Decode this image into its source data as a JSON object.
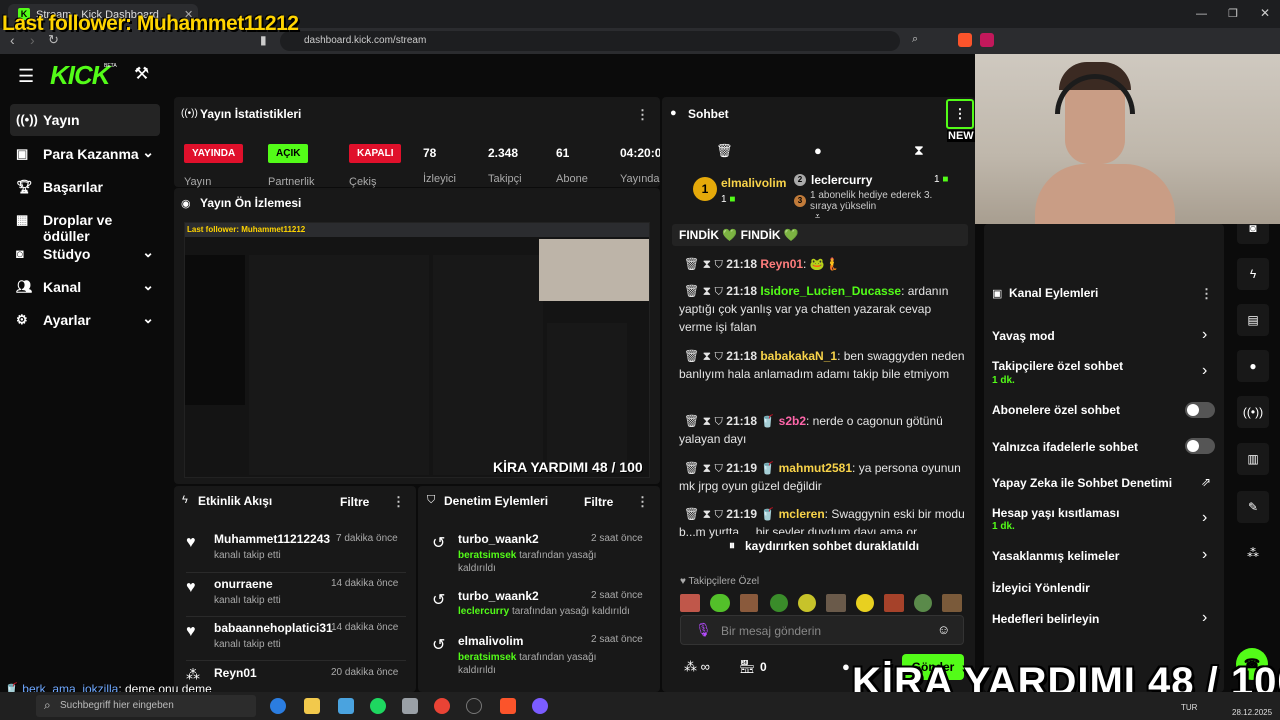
{
  "browser": {
    "tab_title": "Stream - Kick Dashboard",
    "url": "dashboard.kick.com/stream"
  },
  "overlay": {
    "last_follower": "Last follower: Muhammet11212",
    "big_text": "KİRA YARDIMI  48 / 100",
    "chat_overlay_user": "berk_ama_jokzilla",
    "chat_overlay_text": ": deme onu deme"
  },
  "logo": {
    "text": "KICK",
    "beta": "BETA"
  },
  "sidebar": {
    "items": [
      {
        "label": "Yayın",
        "icon": "broadcast-icon"
      },
      {
        "label": "Para Kazanma",
        "icon": "money-icon"
      },
      {
        "label": "Başarılar",
        "icon": "trophy-icon"
      },
      {
        "label": "Droplar ve ödüller",
        "icon": "gift-icon"
      },
      {
        "label": "Stüdyo",
        "icon": "studio-icon"
      },
      {
        "label": "Kanal",
        "icon": "users-icon"
      },
      {
        "label": "Ayarlar",
        "icon": "gear-icon"
      }
    ]
  },
  "stats": {
    "title": "Yayın İstatistikleri",
    "badges": [
      {
        "text": "YAYINDA",
        "label": "Yayın",
        "color": "#e0102b"
      },
      {
        "text": "AÇIK",
        "label": "Partnerlik",
        "color": "#53fc18"
      },
      {
        "text": "KAPALI",
        "label": "Çekiş",
        "color": "#e0102b"
      }
    ],
    "numbers": [
      {
        "value": "78",
        "label": "İzleyici"
      },
      {
        "value": "2.348",
        "label": "Takipçi"
      },
      {
        "value": "61",
        "label": "Abone"
      },
      {
        "value": "04:20:0",
        "label": "Yayında"
      }
    ]
  },
  "preview": {
    "title": "Yayın Ön İzlemesi",
    "inner_follower": "Last follower: Muhammet11212",
    "inner_big": "KİRA YARDIMI  48 / 100"
  },
  "activity": {
    "title": "Etkinlik Akışı",
    "filter": "Filtre",
    "items": [
      {
        "name": "Muhammet11212243",
        "sub": "kanalı takip etti",
        "time": "7 dakika önce"
      },
      {
        "name": "onurraene",
        "sub": "kanalı takip etti",
        "time": "14 dakika önce"
      },
      {
        "name": "babaannehoplatici31",
        "sub": "kanalı takip etti",
        "time": "14 dakika önce"
      },
      {
        "name": "Reyn01",
        "sub": "",
        "time": "20 dakika önce"
      }
    ]
  },
  "moderation": {
    "title": "Denetim Eylemleri",
    "filter": "Filtre",
    "items": [
      {
        "user": "turbo_waank2",
        "by": "beratsimsek",
        "text": "tarafından yasağı kaldırıldı",
        "time": "2 saat önce"
      },
      {
        "user": "turbo_waank2",
        "by": "leclercurry",
        "text": "tarafından yasağı kaldırıldı",
        "time": "2 saat önce"
      },
      {
        "user": "elmalivolim",
        "by": "beratsimsek",
        "text": "tarafından yasağı kaldırıldı",
        "time": "2 saat önce"
      }
    ]
  },
  "chat": {
    "title": "Sohbet",
    "new_label": "NEW",
    "top_gifter": {
      "name": "elmalivolim",
      "count": "1",
      "rank": "1"
    },
    "gift_user": {
      "name": "leclercurry",
      "count": "1",
      "text": "1 abonelik hediye ederek 3. sıraya yükselin",
      "rank": "3"
    },
    "pinned": "FINDİK 💚 FINDİK 💚",
    "messages": [
      {
        "time": "21:18",
        "user": "Reyn01",
        "color": "#ff7d7d",
        "text": "🐸🧜"
      },
      {
        "time": "21:18",
        "user": "Isidore_Lucien_Ducasse",
        "color": "#53fc18",
        "text": "ardanın yaptığı çok yanlış var ya chatten yazarak cevap verme işi falan"
      },
      {
        "time": "21:18",
        "user": "babakakaN_1",
        "color": "#f8d34a",
        "text": "ben swaggyden neden banlıyım hala anlamadım adamı takip bile etmiyom"
      },
      {
        "time": "21:18",
        "user": "s2b2",
        "color": "#ff66aa",
        "text": "nerde o cagonun götünü yalayan dayı"
      },
      {
        "time": "21:19",
        "user": "mahmut2581",
        "color": "#f8d34a",
        "text": "ya persona oyunun mk jrpg oyun güzel değildir"
      },
      {
        "time": "21:19",
        "user": "mcleren",
        "color": "#f8d34a",
        "text": "Swaggynin eski bir modu b...m yurtta ... bir seyler duydum dayı ama or"
      }
    ],
    "paused": "kaydırırken sohbet duraklatıldı",
    "follower_only": "Takipçilere Özel",
    "input_placeholder": "Bir mesaj gönderin",
    "points": "0",
    "send": "Gönder"
  },
  "channel_actions": {
    "title": "Kanal Eylemleri",
    "items": [
      {
        "label": "Yavaş mod",
        "sub": "",
        "control": "chevron"
      },
      {
        "label": "Takipçilere özel sohbet",
        "sub": "1 dk.",
        "control": "chevron"
      },
      {
        "label": "Abonelere özel sohbet",
        "sub": "",
        "control": "toggle"
      },
      {
        "label": "Yalnızca ifadelerle sohbet",
        "sub": "",
        "control": "toggle"
      },
      {
        "label": "Yapay Zeka ile Sohbet Denetimi",
        "sub": "",
        "control": "external"
      },
      {
        "label": "Hesap yaşı kısıtlaması",
        "sub": "1 dk.",
        "control": "chevron"
      },
      {
        "label": "Yasaklanmış kelimeler",
        "sub": "",
        "control": "chevron"
      },
      {
        "label": "İzleyici Yönlendir",
        "sub": "",
        "control": "none"
      },
      {
        "label": "Hedefleri belirleyin",
        "sub": "",
        "control": "chevron"
      }
    ]
  },
  "taskbar": {
    "search_placeholder": "Suchbegriff hier eingeben",
    "lang": "TUR",
    "date": "28.12.2025"
  },
  "colors": {
    "accent": "#53fc18",
    "danger": "#e0102b",
    "panel": "#181818",
    "bg": "#0b0b0b"
  }
}
